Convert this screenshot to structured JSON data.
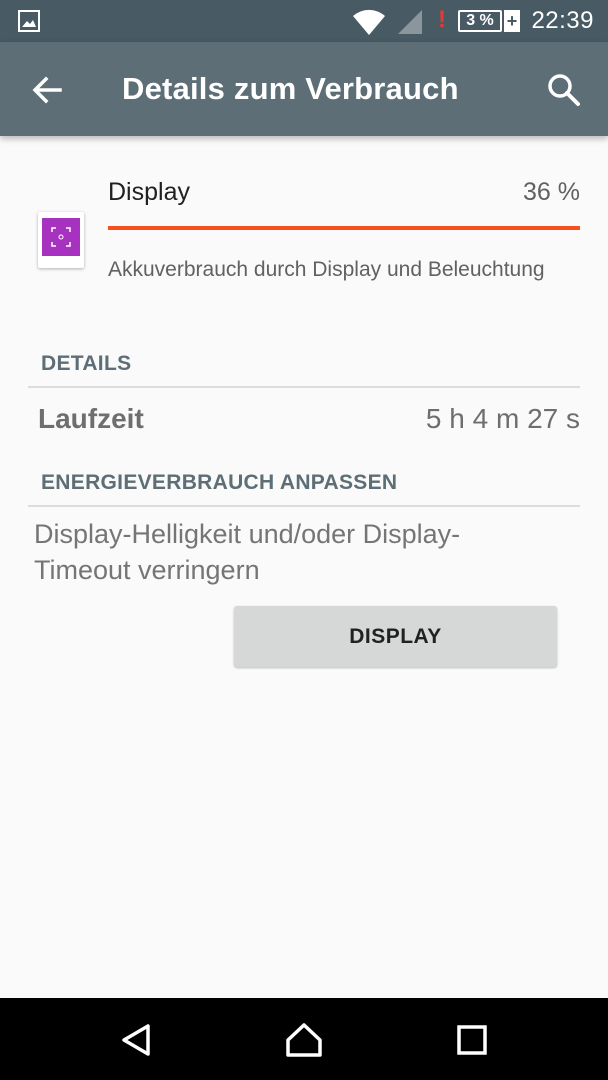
{
  "status_bar": {
    "battery_text": "3 %",
    "battery_plus": "+",
    "alert_glyph": "!",
    "time": "22:39",
    "icons": [
      "image-notification-icon",
      "wifi-icon",
      "cell-signal-icon",
      "battery-icon"
    ]
  },
  "app_bar": {
    "title": "Details zum Verbrauch",
    "icons": [
      "arrow-back-icon",
      "search-icon"
    ]
  },
  "usage_item": {
    "title": "Display",
    "percent": "36 %",
    "progress": 1.0,
    "description": "Akkuverbrauch durch Display und Beleuchtung",
    "icon": "display-app-icon"
  },
  "details": {
    "header": "DETAILS",
    "runtime_label": "Laufzeit",
    "runtime_value": "5 h 4 m 27 s"
  },
  "adjust": {
    "header": "ENERGIEVERBRAUCH ANPASSEN",
    "hint": "Display-Helligkeit und/oder Display-Timeout verringern",
    "button_label": "DISPLAY"
  },
  "nav_bar": {
    "icons": [
      "nav-back-icon",
      "nav-home-icon",
      "nav-recents-icon"
    ]
  },
  "colors": {
    "status_bar": "#485a63",
    "app_bar": "#5d6e76",
    "progress": "#f4511e",
    "app_icon": "#a832c0",
    "background": "#fafafa"
  }
}
